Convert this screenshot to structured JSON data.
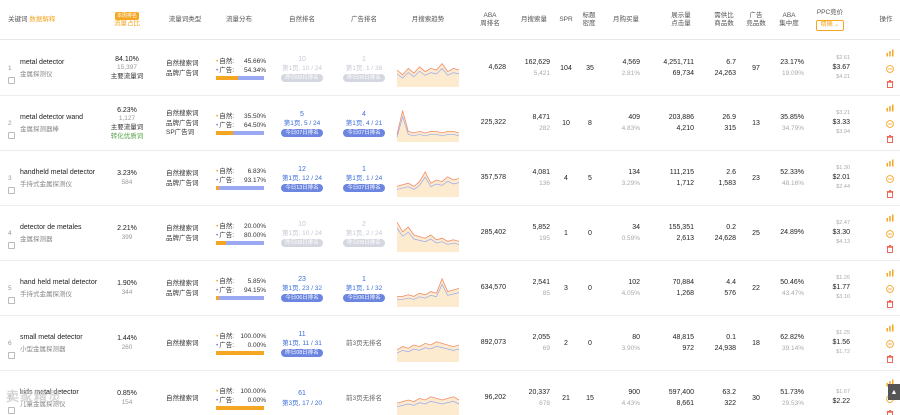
{
  "header": {
    "keyword": "关键词",
    "keyword_link": "数据解释",
    "share_badge": "本周排名",
    "share_label": "流量占比",
    "type": "流量词类型",
    "dist": "流量分布",
    "organic": "自然排名",
    "ad": "广告排名",
    "trend": "月搜索趋势",
    "aba_rank": [
      "ABA",
      "周排名"
    ],
    "monthly_search": "月搜索量",
    "spr": "SPR",
    "title_density": [
      "标题",
      "密度"
    ],
    "monthly_buy": "月购买量",
    "impr_click": [
      "展示量",
      "点击量"
    ],
    "supply_ratio": [
      "需供比",
      "商品数"
    ],
    "ad_competitors": [
      "广告",
      "竞品数"
    ],
    "aba_conc": [
      "ABA",
      "集中度"
    ],
    "ppc": "PPC竞价",
    "ppc_btn": "精确 ⌄",
    "ops": "操作"
  },
  "rows": [
    {
      "idx": "1",
      "kw_en": "metal detector",
      "kw_cn": "金属探测仪",
      "share": "84.10%",
      "share_sub": "15,397",
      "tag": "主要流量词",
      "tag2": "",
      "type": [
        "自然搜索词",
        "品牌广告词"
      ],
      "dist_nat": "45.66%",
      "dist_ad": "54.34%",
      "dist_nat_frac": 0.457,
      "org_big": "10",
      "org_pg": "第1页, 10 / 24",
      "org_badge": "昨日08日排名",
      "org_muted": true,
      "ad_big": "1",
      "ad_pg": "第1页, 1 / 38",
      "ad_badge": "昨日08日排名",
      "ad_muted": true,
      "ad_none": "",
      "aba": "4,628",
      "aba_b": "",
      "ms": "162,629",
      "ms_b": "5,421",
      "spr": "104",
      "td": "35",
      "mb": "4,569",
      "mb_b": "2.81%",
      "impr": "4,251,711",
      "click": "69,734",
      "sr": "6.7",
      "sr_b": "24,263",
      "adc": "97",
      "conc": "23.17%",
      "conc_b": "19.09%",
      "ppc_hi": "$2.61",
      "ppc": "$3.67",
      "ppc_lo": "$4.21",
      "trend": [
        0.5,
        0.35,
        0.55,
        0.4,
        0.6,
        0.45,
        0.55,
        0.5,
        0.7,
        0.45,
        0.55,
        0.5
      ]
    },
    {
      "idx": "2",
      "kw_en": "metal detector wand",
      "kw_cn": "金属探测器棒",
      "share": "6.23%",
      "share_sub": "1,127",
      "tag": "主要流量词",
      "tag2": "转化优质词",
      "type": [
        "自然搜索词",
        "品牌广告词",
        "SP广告词"
      ],
      "dist_nat": "35.50%",
      "dist_ad": "64.50%",
      "dist_nat_frac": 0.355,
      "org_big": "5",
      "org_pg": "第1页, 5 / 24",
      "org_badge": "今日07日排名",
      "org_muted": false,
      "ad_big": "4",
      "ad_pg": "第1页, 4 / 21",
      "ad_badge": "今日07日排名",
      "ad_muted": false,
      "ad_none": "",
      "aba": "225,322",
      "aba_b": "",
      "ms": "8,471",
      "ms_b": "282",
      "spr": "10",
      "td": "8",
      "mb": "409",
      "mb_b": "4.83%",
      "impr": "203,886",
      "click": "4,210",
      "sr": "26.9",
      "sr_b": "315",
      "adc": "13",
      "conc": "35.85%",
      "conc_b": "34.79%",
      "ppc_hi": "$3.21",
      "ppc": "$3.33",
      "ppc_lo": "$3.94",
      "trend": [
        0.2,
        0.95,
        0.3,
        0.25,
        0.3,
        0.25,
        0.3,
        0.3,
        0.25,
        0.3,
        0.3,
        0.25
      ]
    },
    {
      "idx": "3",
      "kw_en": "handheld metal detector",
      "kw_cn": "手持式金属探测仪",
      "share": "3.23%",
      "share_sub": "584",
      "tag": "",
      "tag2": "",
      "type": [
        "自然搜索词",
        "品牌广告词"
      ],
      "dist_nat": "6.83%",
      "dist_ad": "93.17%",
      "dist_nat_frac": 0.068,
      "org_big": "12",
      "org_pg": "第1页, 12 / 24",
      "org_badge": "今日13日排名",
      "org_muted": false,
      "ad_big": "1",
      "ad_pg": "第1页, 1 / 24",
      "ad_badge": "今日07日排名",
      "ad_muted": false,
      "ad_none": "",
      "aba": "357,578",
      "aba_b": "",
      "ms": "4,081",
      "ms_b": "136",
      "spr": "4",
      "td": "5",
      "mb": "134",
      "mb_b": "3.29%",
      "impr": "111,215",
      "click": "1,712",
      "sr": "2.6",
      "sr_b": "1,583",
      "adc": "23",
      "conc": "52.33%",
      "conc_b": "48.16%",
      "ppc_hi": "$1.30",
      "ppc": "$2.01",
      "ppc_lo": "$2.44",
      "trend": [
        0.3,
        0.35,
        0.4,
        0.3,
        0.45,
        0.75,
        0.4,
        0.5,
        0.45,
        0.6,
        0.5,
        0.55
      ]
    },
    {
      "idx": "4",
      "kw_en": "detector de metales",
      "kw_cn": "金属探测器",
      "share": "2.21%",
      "share_sub": "399",
      "tag": "",
      "tag2": "",
      "type": [
        "自然搜索词",
        "品牌广告词"
      ],
      "dist_nat": "20.00%",
      "dist_ad": "80.00%",
      "dist_nat_frac": 0.2,
      "org_big": "10",
      "org_pg": "第1页, 10 / 24",
      "org_badge": "昨日08日排名",
      "org_muted": true,
      "ad_big": "2",
      "ad_pg": "第1页, 2 / 24",
      "ad_badge": "昨日08日排名",
      "ad_muted": true,
      "ad_none": "",
      "aba": "285,402",
      "aba_b": "",
      "ms": "5,852",
      "ms_b": "195",
      "spr": "1",
      "td": "0",
      "mb": "34",
      "mb_b": "0.59%",
      "impr": "155,351",
      "click": "2,613",
      "sr": "0.2",
      "sr_b": "24,628",
      "adc": "25",
      "conc": "24.89%",
      "conc_b": "",
      "ppc_hi": "$2.47",
      "ppc": "$3.30",
      "ppc_lo": "$4.13",
      "trend": [
        0.9,
        0.6,
        0.75,
        0.5,
        0.45,
        0.4,
        0.5,
        0.35,
        0.4,
        0.3,
        0.35,
        0.3
      ]
    },
    {
      "idx": "5",
      "kw_en": "hand held metal detector",
      "kw_cn": "手持式金属探测仪",
      "share": "1.90%",
      "share_sub": "344",
      "tag": "",
      "tag2": "",
      "type": [
        "自然搜索词",
        "品牌广告词"
      ],
      "dist_nat": "5.85%",
      "dist_ad": "94.15%",
      "dist_nat_frac": 0.058,
      "org_big": "23",
      "org_pg": "第1页, 23 / 32",
      "org_badge": "今日06日排名",
      "org_muted": false,
      "ad_big": "1",
      "ad_pg": "第1页, 1 / 32",
      "ad_badge": "今日06日排名",
      "ad_muted": false,
      "ad_none": "",
      "aba": "634,570",
      "aba_b": "",
      "ms": "2,541",
      "ms_b": "85",
      "spr": "3",
      "td": "0",
      "mb": "102",
      "mb_b": "4.05%",
      "impr": "70,884",
      "click": "1,268",
      "sr": "4.4",
      "sr_b": "576",
      "adc": "22",
      "conc": "50.46%",
      "conc_b": "43.47%",
      "ppc_hi": "$1.26",
      "ppc": "$1.77",
      "ppc_lo": "$3.10",
      "trend": [
        0.3,
        0.3,
        0.35,
        0.3,
        0.4,
        0.35,
        0.45,
        0.4,
        0.85,
        0.45,
        0.5,
        0.55
      ]
    },
    {
      "idx": "6",
      "kw_en": "small metal detector",
      "kw_cn": "小型金属探测器",
      "share": "1.44%",
      "share_sub": "260",
      "tag": "",
      "tag2": "",
      "type": [
        "自然搜索词"
      ],
      "dist_nat": "100.00%",
      "dist_ad": "0.00%",
      "dist_nat_frac": 1.0,
      "org_big": "11",
      "org_pg": "第1页, 11 / 31",
      "org_badge": "昨日08日排名",
      "org_muted": false,
      "ad_big": "",
      "ad_pg": "",
      "ad_badge": "",
      "ad_muted": false,
      "ad_none": "前3页无排名",
      "aba": "892,073",
      "aba_b": "",
      "ms": "2,055",
      "ms_b": "69",
      "spr": "2",
      "td": "0",
      "mb": "80",
      "mb_b": "3.90%",
      "impr": "48,815",
      "click": "972",
      "sr": "0.1",
      "sr_b": "24,938",
      "adc": "18",
      "conc": "62.82%",
      "conc_b": "39.14%",
      "ppc_hi": "$1.25",
      "ppc": "$1.56",
      "ppc_lo": "$1.72",
      "trend": [
        0.35,
        0.45,
        0.4,
        0.5,
        0.45,
        0.55,
        0.5,
        0.6,
        0.55,
        0.5,
        0.45,
        0.5
      ]
    },
    {
      "idx": "7",
      "kw_en": "kids metal detector",
      "kw_cn": "儿童金属探测仪",
      "share": "0.85%",
      "share_sub": "154",
      "tag": "",
      "tag2": "",
      "type": [
        "自然搜索词"
      ],
      "dist_nat": "100.00%",
      "dist_ad": "0.00%",
      "dist_nat_frac": 1.0,
      "org_big": "61",
      "org_pg": "第3页, 17 / 20",
      "org_badge": "",
      "org_muted": false,
      "ad_big": "",
      "ad_pg": "",
      "ad_badge": "",
      "ad_muted": false,
      "ad_none": "前3页无排名",
      "aba": "96,202",
      "aba_b": "",
      "ms": "20,337",
      "ms_b": "678",
      "spr": "21",
      "td": "15",
      "mb": "900",
      "mb_b": "4.43%",
      "impr": "597,400",
      "click": "8,661",
      "sr": "63.2",
      "sr_b": "322",
      "adc": "30",
      "conc": "51.73%",
      "conc_b": "29.53%",
      "ppc_hi": "$1.67",
      "ppc": "$2.22",
      "ppc_lo": "",
      "trend": [
        0.4,
        0.45,
        0.5,
        0.45,
        0.55,
        0.5,
        0.6,
        0.55,
        0.5,
        0.55,
        0.6,
        0.5
      ]
    }
  ],
  "watermark": "卖家精灵",
  "icons": {
    "chart": "bar-chart-icon",
    "minus": "minus-circle-icon",
    "trash": "trash-icon"
  },
  "colors": {
    "orange": "#f5a623",
    "blue": "#3b6fd9",
    "red": "#e8432e"
  }
}
